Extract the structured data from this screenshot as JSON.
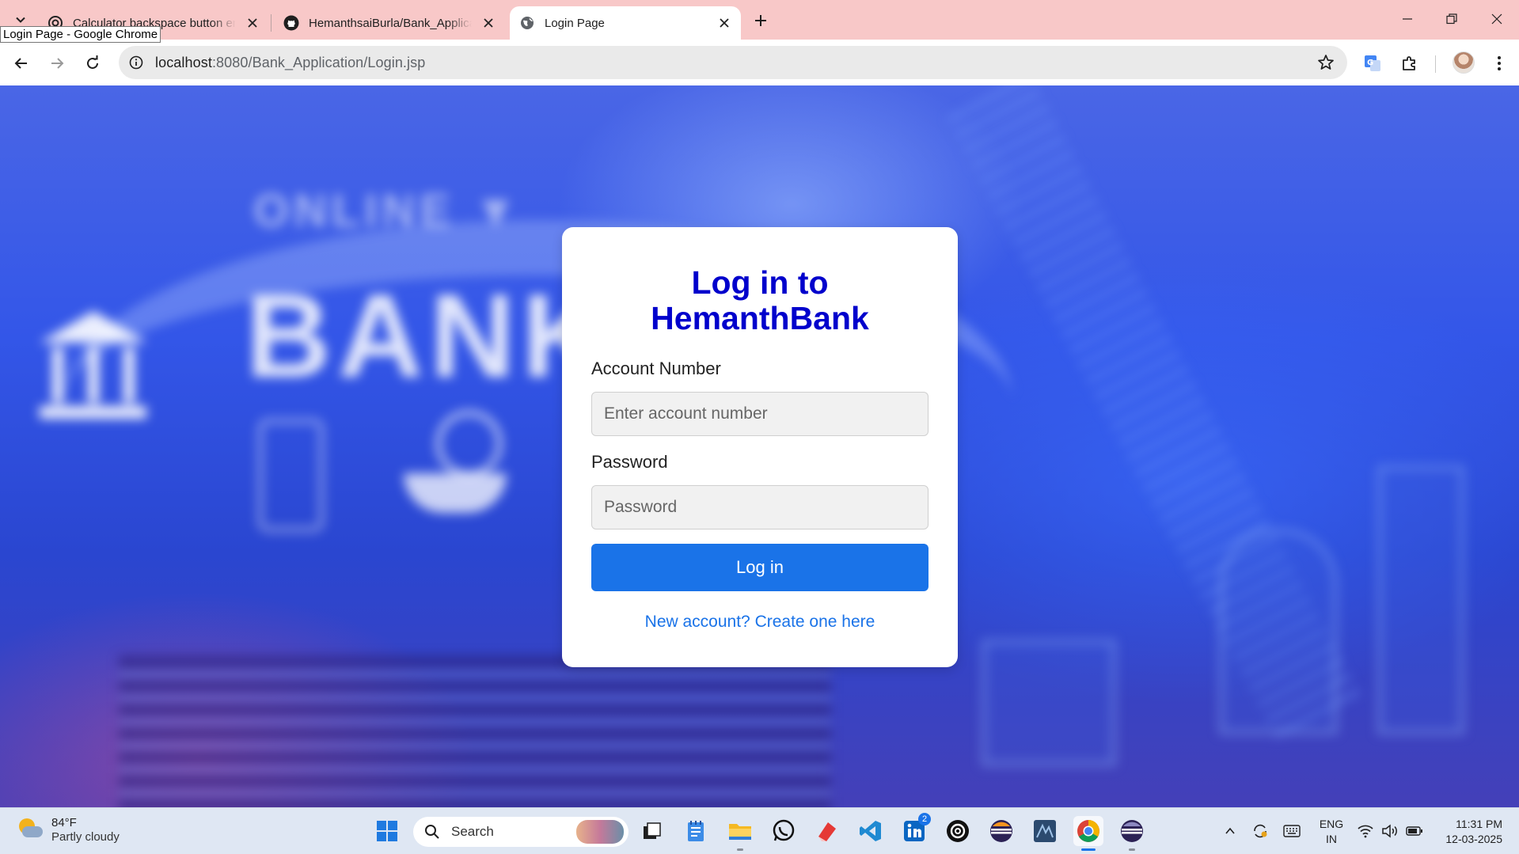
{
  "browser": {
    "tabs": [
      {
        "title": "Calculator backspace button en",
        "favicon": "chatgpt-icon"
      },
      {
        "title": "HemanthsaiBurla/Bank_Applicati",
        "favicon": "github-icon"
      },
      {
        "title": "Login Page",
        "favicon": "globe-icon",
        "active": true
      }
    ],
    "tooltip": "Login Page - Google Chrome",
    "url_host": "localhost",
    "url_path": ":8080/Bank_Application/Login.jsp"
  },
  "login": {
    "heading": "Log in to HemanthBank",
    "account_label": "Account Number",
    "account_placeholder": "Enter account number",
    "password_label": "Password",
    "password_placeholder": "Password",
    "submit_label": "Log in",
    "signup_link": "New account? Create one here"
  },
  "background": {
    "word_top": "ONLINE ▼",
    "word_main": "BANKIN"
  },
  "colors": {
    "heading": "#0000cc",
    "primary": "#1a73e8",
    "tabstrip": "#f8c8c8"
  },
  "taskbar": {
    "weather_temp": "84°F",
    "weather_condition": "Partly cloudy",
    "search_label": "Search",
    "linkedin_badge": "2",
    "lang_top": "ENG",
    "lang_bottom": "IN",
    "time": "11:31 PM",
    "date": "12-03-2025"
  }
}
